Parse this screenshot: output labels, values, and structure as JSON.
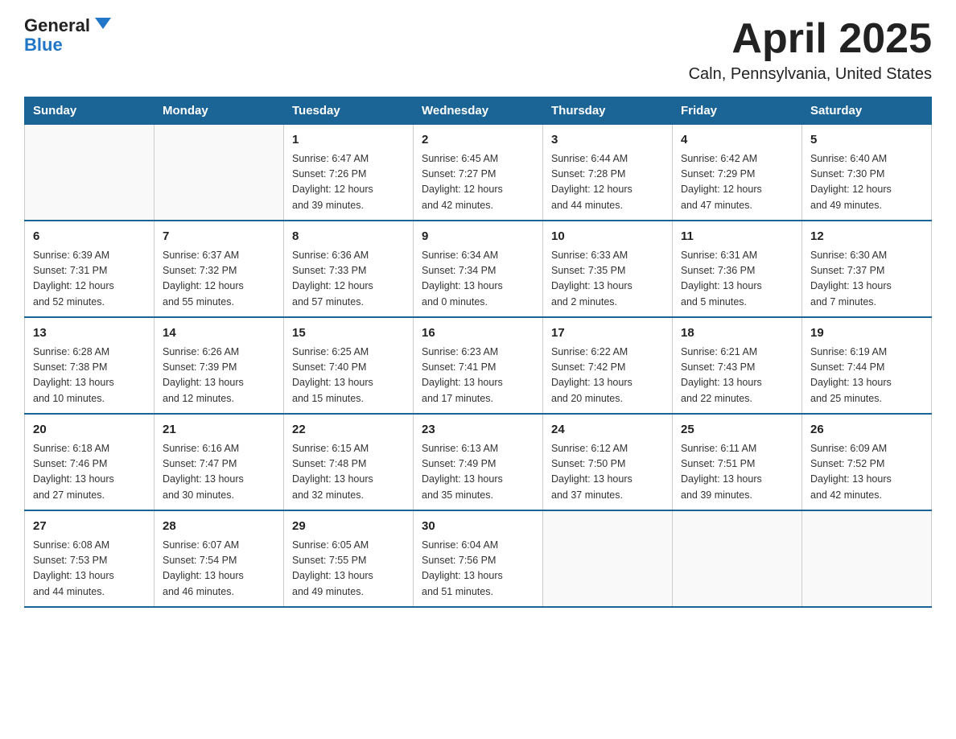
{
  "header": {
    "logo_general": "General",
    "logo_blue": "Blue",
    "month_title": "April 2025",
    "location": "Caln, Pennsylvania, United States"
  },
  "days_of_week": [
    "Sunday",
    "Monday",
    "Tuesday",
    "Wednesday",
    "Thursday",
    "Friday",
    "Saturday"
  ],
  "weeks": [
    [
      {
        "day": "",
        "info": ""
      },
      {
        "day": "",
        "info": ""
      },
      {
        "day": "1",
        "info": "Sunrise: 6:47 AM\nSunset: 7:26 PM\nDaylight: 12 hours\nand 39 minutes."
      },
      {
        "day": "2",
        "info": "Sunrise: 6:45 AM\nSunset: 7:27 PM\nDaylight: 12 hours\nand 42 minutes."
      },
      {
        "day": "3",
        "info": "Sunrise: 6:44 AM\nSunset: 7:28 PM\nDaylight: 12 hours\nand 44 minutes."
      },
      {
        "day": "4",
        "info": "Sunrise: 6:42 AM\nSunset: 7:29 PM\nDaylight: 12 hours\nand 47 minutes."
      },
      {
        "day": "5",
        "info": "Sunrise: 6:40 AM\nSunset: 7:30 PM\nDaylight: 12 hours\nand 49 minutes."
      }
    ],
    [
      {
        "day": "6",
        "info": "Sunrise: 6:39 AM\nSunset: 7:31 PM\nDaylight: 12 hours\nand 52 minutes."
      },
      {
        "day": "7",
        "info": "Sunrise: 6:37 AM\nSunset: 7:32 PM\nDaylight: 12 hours\nand 55 minutes."
      },
      {
        "day": "8",
        "info": "Sunrise: 6:36 AM\nSunset: 7:33 PM\nDaylight: 12 hours\nand 57 minutes."
      },
      {
        "day": "9",
        "info": "Sunrise: 6:34 AM\nSunset: 7:34 PM\nDaylight: 13 hours\nand 0 minutes."
      },
      {
        "day": "10",
        "info": "Sunrise: 6:33 AM\nSunset: 7:35 PM\nDaylight: 13 hours\nand 2 minutes."
      },
      {
        "day": "11",
        "info": "Sunrise: 6:31 AM\nSunset: 7:36 PM\nDaylight: 13 hours\nand 5 minutes."
      },
      {
        "day": "12",
        "info": "Sunrise: 6:30 AM\nSunset: 7:37 PM\nDaylight: 13 hours\nand 7 minutes."
      }
    ],
    [
      {
        "day": "13",
        "info": "Sunrise: 6:28 AM\nSunset: 7:38 PM\nDaylight: 13 hours\nand 10 minutes."
      },
      {
        "day": "14",
        "info": "Sunrise: 6:26 AM\nSunset: 7:39 PM\nDaylight: 13 hours\nand 12 minutes."
      },
      {
        "day": "15",
        "info": "Sunrise: 6:25 AM\nSunset: 7:40 PM\nDaylight: 13 hours\nand 15 minutes."
      },
      {
        "day": "16",
        "info": "Sunrise: 6:23 AM\nSunset: 7:41 PM\nDaylight: 13 hours\nand 17 minutes."
      },
      {
        "day": "17",
        "info": "Sunrise: 6:22 AM\nSunset: 7:42 PM\nDaylight: 13 hours\nand 20 minutes."
      },
      {
        "day": "18",
        "info": "Sunrise: 6:21 AM\nSunset: 7:43 PM\nDaylight: 13 hours\nand 22 minutes."
      },
      {
        "day": "19",
        "info": "Sunrise: 6:19 AM\nSunset: 7:44 PM\nDaylight: 13 hours\nand 25 minutes."
      }
    ],
    [
      {
        "day": "20",
        "info": "Sunrise: 6:18 AM\nSunset: 7:46 PM\nDaylight: 13 hours\nand 27 minutes."
      },
      {
        "day": "21",
        "info": "Sunrise: 6:16 AM\nSunset: 7:47 PM\nDaylight: 13 hours\nand 30 minutes."
      },
      {
        "day": "22",
        "info": "Sunrise: 6:15 AM\nSunset: 7:48 PM\nDaylight: 13 hours\nand 32 minutes."
      },
      {
        "day": "23",
        "info": "Sunrise: 6:13 AM\nSunset: 7:49 PM\nDaylight: 13 hours\nand 35 minutes."
      },
      {
        "day": "24",
        "info": "Sunrise: 6:12 AM\nSunset: 7:50 PM\nDaylight: 13 hours\nand 37 minutes."
      },
      {
        "day": "25",
        "info": "Sunrise: 6:11 AM\nSunset: 7:51 PM\nDaylight: 13 hours\nand 39 minutes."
      },
      {
        "day": "26",
        "info": "Sunrise: 6:09 AM\nSunset: 7:52 PM\nDaylight: 13 hours\nand 42 minutes."
      }
    ],
    [
      {
        "day": "27",
        "info": "Sunrise: 6:08 AM\nSunset: 7:53 PM\nDaylight: 13 hours\nand 44 minutes."
      },
      {
        "day": "28",
        "info": "Sunrise: 6:07 AM\nSunset: 7:54 PM\nDaylight: 13 hours\nand 46 minutes."
      },
      {
        "day": "29",
        "info": "Sunrise: 6:05 AM\nSunset: 7:55 PM\nDaylight: 13 hours\nand 49 minutes."
      },
      {
        "day": "30",
        "info": "Sunrise: 6:04 AM\nSunset: 7:56 PM\nDaylight: 13 hours\nand 51 minutes."
      },
      {
        "day": "",
        "info": ""
      },
      {
        "day": "",
        "info": ""
      },
      {
        "day": "",
        "info": ""
      }
    ]
  ]
}
